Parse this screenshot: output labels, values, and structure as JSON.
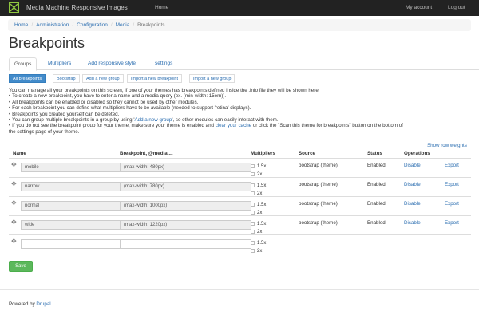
{
  "topbar": {
    "brand": "Media Machine Responsive Images",
    "home": "Home",
    "my_account": "My account",
    "logout": "Log out"
  },
  "breadcrumb": [
    "Home",
    "Administration",
    "Configuration",
    "Media",
    "Breakpoints"
  ],
  "page_title": "Breakpoints",
  "tabs": [
    "Groups",
    "Multipliers",
    "Add responsive style",
    "settings"
  ],
  "subtabs": [
    "All breakpoints",
    "Bootstrap",
    "Add a new group",
    "Import a new breakpoint",
    "Import a new group"
  ],
  "description": {
    "intro": "You can manage all your breakpoints on this screen, if one of your themes has breakpoints defined inside the .info file they will be shown here.",
    "b1": "To create a new breakpoint, you have to enter a name and a media query (ex. (min-width: 15em)).",
    "b2": "All breakpoints can be enabled or disabled so they cannot be used by other modules.",
    "b3": "For each breakpoint you can define what multipliers have to be available (needed to support 'retina' displays).",
    "b4": "Breakpoints you created yourself can be deleted.",
    "b5_pre": "You can group multiple breakpoints in a group by using '",
    "b5_link": "Add a new group",
    "b5_post": "', so other modules can easily interact with them.",
    "b6_pre": "If you do not see the breakpoint group for your theme, make sure your theme is enabled and ",
    "b6_link": "clear your cache",
    "b6_post": " or click the \"Scan this theme for breakpoints\" button on the bottom of",
    "b6_line2": "the settings page of your theme."
  },
  "show_row_weights": "Show row weights",
  "table": {
    "headers": {
      "name": "Name",
      "breakpoint": "Breakpoint, @media ...",
      "multipliers": "Multipliers",
      "source": "Source",
      "status": "Status",
      "operations": "Operations"
    },
    "multiplier_options": [
      "1.5x",
      "2x"
    ],
    "rows": [
      {
        "name": "mobile",
        "breakpoint": "(max-width: 480px)",
        "source": "bootstrap (theme)",
        "status": "Enabled",
        "disable": "Disable",
        "export": "Export"
      },
      {
        "name": "narrow",
        "breakpoint": "(max-width: 780px)",
        "source": "bootstrap (theme)",
        "status": "Enabled",
        "disable": "Disable",
        "export": "Export"
      },
      {
        "name": "normal",
        "breakpoint": "(max-width: 1000px)",
        "source": "bootstrap (theme)",
        "status": "Enabled",
        "disable": "Disable",
        "export": "Export"
      },
      {
        "name": "wide",
        "breakpoint": "(max-width: 1220px)",
        "source": "bootstrap (theme)",
        "status": "Enabled",
        "disable": "Disable",
        "export": "Export"
      }
    ]
  },
  "save_label": "Save",
  "footer": {
    "powered_by": "Powered by ",
    "drupal": "Drupal"
  },
  "colors": {
    "topbar": "#222222",
    "accent": "#428bca",
    "link": "#2a6db0",
    "save": "#5cb85c"
  },
  "icons": {
    "logo": "media-machine-logo-icon",
    "drag": "drag-handle-icon"
  }
}
